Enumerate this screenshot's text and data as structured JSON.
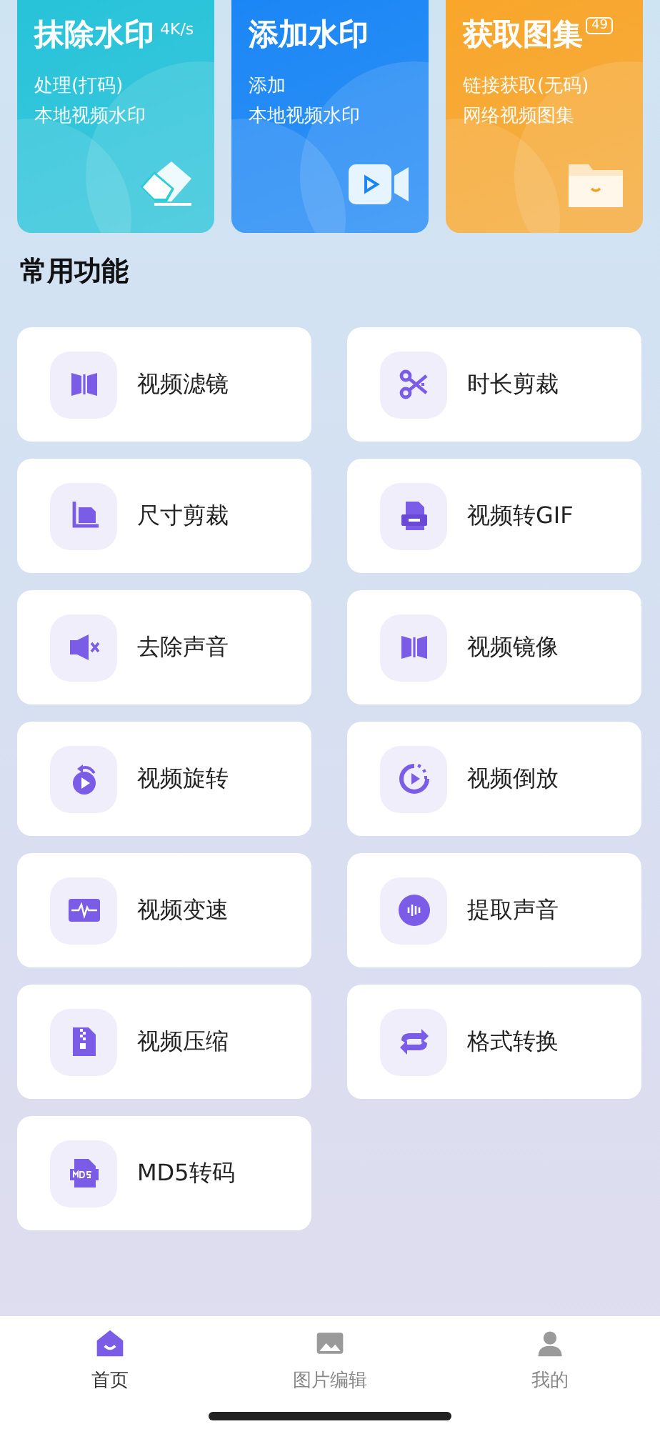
{
  "status_bar": {
    "speed": "4K/s",
    "battery": "49"
  },
  "feature_cards": [
    {
      "title": "抹除水印",
      "lines": [
        "处理(打码)",
        "本地视频水印"
      ],
      "color": "#27c3d9"
    },
    {
      "title": "添加水印",
      "lines": [
        "添加",
        "本地视频水印"
      ],
      "color": "#1a86f5"
    },
    {
      "title": "获取图集",
      "lines": [
        "链接获取(无码)",
        "网络视频图集"
      ],
      "color": "#f9a62a"
    }
  ],
  "section_title": "常用功能",
  "functions": [
    {
      "label": "视频滤镜"
    },
    {
      "label": "时长剪裁"
    },
    {
      "label": "尺寸剪裁"
    },
    {
      "label": "视频转GIF"
    },
    {
      "label": "去除声音"
    },
    {
      "label": "视频镜像"
    },
    {
      "label": "视频旋转"
    },
    {
      "label": "视频倒放"
    },
    {
      "label": "视频变速"
    },
    {
      "label": "提取声音"
    },
    {
      "label": "视频压缩"
    },
    {
      "label": "格式转换"
    },
    {
      "label": "MD5转码"
    }
  ],
  "bottom_nav": [
    {
      "label": "首页",
      "selected": true
    },
    {
      "label": "图片编辑",
      "selected": false
    },
    {
      "label": "我的",
      "selected": false
    }
  ]
}
